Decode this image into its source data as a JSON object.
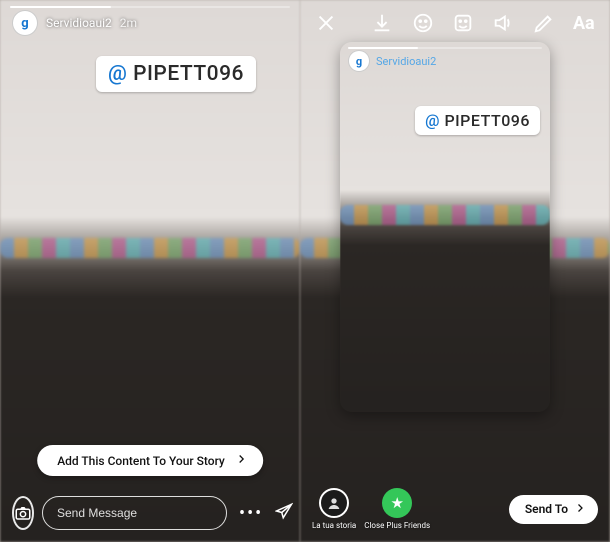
{
  "colors": {
    "mention_at": "#1677d1",
    "close_friends": "#34c759"
  },
  "left": {
    "username": "Servidioaui2",
    "time": "2m",
    "avatar_letter": "g",
    "mention_prefix": "@ ",
    "mention_handle": "PIPETT096",
    "cta_label": "Add This Content To Your Story",
    "message_placeholder": "Send Message"
  },
  "right": {
    "repost": {
      "avatar_letter": "g",
      "username": "Servidioaui2",
      "mention_prefix": "@ ",
      "mention_handle": "PIPETT096"
    },
    "tools": {
      "close": "close-icon",
      "save": "download-icon",
      "face": "face-filter-icon",
      "sticker": "sticker-icon",
      "sound": "sound-on-icon",
      "draw": "draw-icon",
      "text": "Aa"
    },
    "destinations": {
      "your_story_label": "La tua storia",
      "close_friends_label": "Close Plus Friends"
    },
    "send_to_label": "Send To"
  }
}
